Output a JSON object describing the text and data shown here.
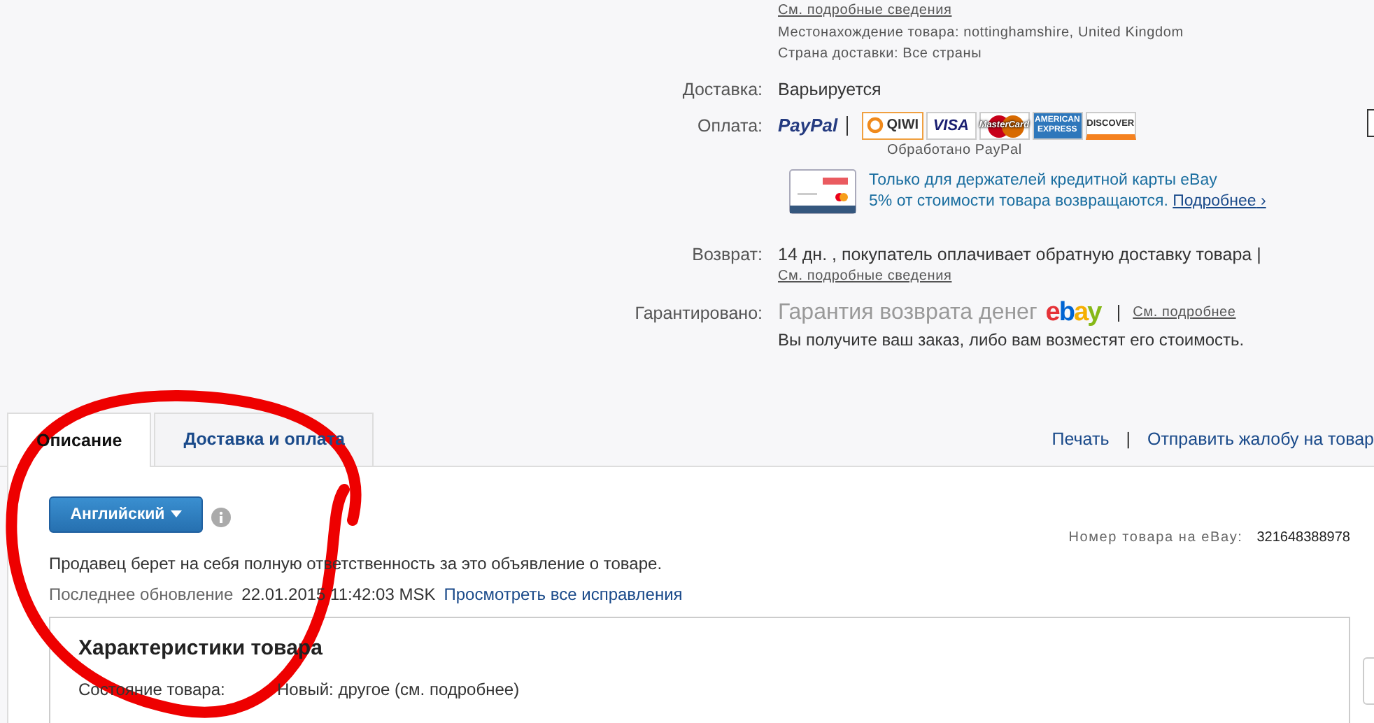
{
  "top_details": {
    "link": "См. подробные сведения",
    "location": "Местонахождение товара: nottinghamshire, United Kingdom",
    "ship_to": "Страна доставки: Все страны"
  },
  "delivery": {
    "label": "Доставка:",
    "value": "Варьируется"
  },
  "payment": {
    "label": "Оплата:",
    "logos": [
      {
        "kind": "paypal",
        "text": "PayPal"
      },
      {
        "kind": "qiwi",
        "text": "QIWI"
      },
      {
        "kind": "visa",
        "text": "VISA"
      },
      {
        "kind": "mastercard",
        "text": "MasterCard"
      },
      {
        "kind": "amex",
        "text": "AMERICAN EXPRESS"
      },
      {
        "kind": "discover",
        "text": "DISCOVER"
      }
    ],
    "processed_by": "Обработано PayPal",
    "promo": {
      "line1": "Только для держателей кредитной карты eBay",
      "line2": "5% от стоимости товара возвращаются.",
      "link": "Подробнее",
      "arrow": "›"
    }
  },
  "returns": {
    "label": "Возврат:",
    "value": "14 дн. , покупатель оплачивает обратную доставку товара |",
    "link": "См. подробные сведения"
  },
  "guarantee": {
    "label": "Гарантировано:",
    "title": "Гарантия возврата денег",
    "logo": "ebay",
    "link": "См. подробнее",
    "note": "Вы получите ваш заказ, либо вам возместят его стоимость."
  },
  "tabs": [
    {
      "label": "Описание",
      "selected": true
    },
    {
      "label": "Доставка и оплата",
      "selected": false
    }
  ],
  "tab_links": {
    "print": "Печать",
    "separator": "|",
    "report": "Отправить жалобу на товар"
  },
  "language_button": "Английский",
  "item_number": {
    "label": "Номер товара на eBay:",
    "value": "321648388978"
  },
  "responsibility_note": "Продавец берет на себя полную ответственность за это объявление о товаре.",
  "last_update": {
    "label": "Последнее обновление",
    "value": "22.01.2015 11:42:03 MSK",
    "link": "Просмотреть все исправления"
  },
  "specs": {
    "title": "Характеристики товара",
    "rows": [
      {
        "label": "Состояние товара:",
        "value": "Новый: другое (см. подробнее)"
      }
    ]
  }
}
